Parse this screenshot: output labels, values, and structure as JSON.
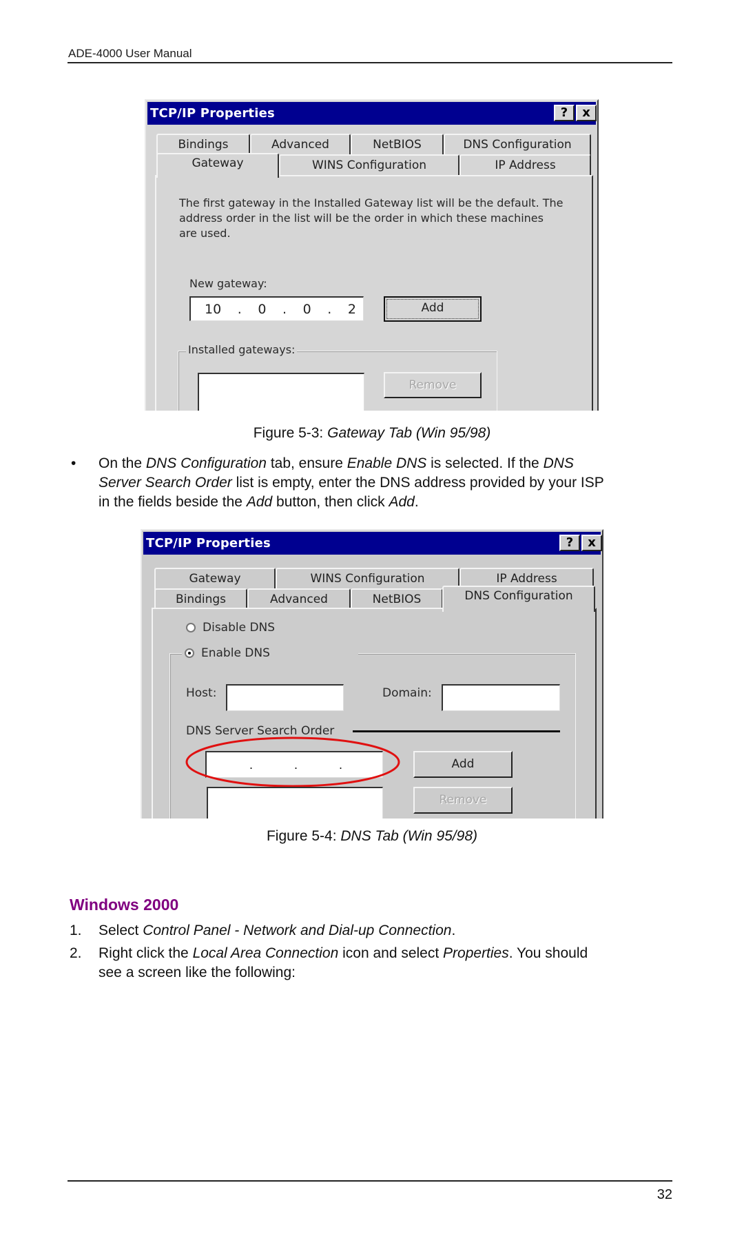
{
  "header": {
    "title": "ADE-4000 User Manual"
  },
  "figure1": {
    "dialog_title": "TCP/IP Properties",
    "help_button": "?",
    "close_button": "x",
    "tabs_row_back": [
      "Bindings",
      "Advanced",
      "NetBIOS",
      "DNS Configuration"
    ],
    "tabs_row_front": [
      "Gateway",
      "WINS Configuration",
      "IP Address"
    ],
    "active_tab": "Gateway",
    "description": [
      "The first gateway in the Installed Gateway list will be the default. The",
      "address order in the list will be the order in which these machines",
      "are used."
    ],
    "new_gateway_label": "New gateway:",
    "new_gateway_value": [
      "10",
      "0",
      "0",
      "2"
    ],
    "add_button": "Add",
    "installed_label": "Installed gateways:",
    "remove_button": "Remove",
    "caption_prefix": "Figure 5-3: ",
    "caption_italic": "Gateway Tab (Win 95/98)"
  },
  "bullet": {
    "symbol": "•",
    "segments": [
      {
        "t": "On the ",
        "i": false
      },
      {
        "t": "DNS Configuration",
        "i": true
      },
      {
        "t": " tab, ensure ",
        "i": false
      },
      {
        "t": "Enable DNS",
        "i": true
      },
      {
        "t": " is selected. If the ",
        "i": false
      },
      {
        "t": "DNS Server Search Order",
        "i": true
      },
      {
        "t": " list is empty, enter the DNS address provided by your ISP in the fields beside the ",
        "i": false
      },
      {
        "t": "Add",
        "i": true
      },
      {
        "t": " button, then click ",
        "i": false
      },
      {
        "t": "Add",
        "i": true
      },
      {
        "t": ".",
        "i": false
      }
    ],
    "lines": [
      [
        {
          "t": "On the ",
          "i": false
        },
        {
          "t": "DNS Configuration",
          "i": true
        },
        {
          "t": " tab, ensure ",
          "i": false
        },
        {
          "t": "Enable DNS",
          "i": true
        },
        {
          "t": " is selected. If the ",
          "i": false
        },
        {
          "t": "DNS",
          "i": true
        }
      ],
      [
        {
          "t": "Server Search Order",
          "i": true
        },
        {
          "t": " list is empty, enter the DNS address provided by your ISP",
          "i": false
        }
      ],
      [
        {
          "t": "in the fields beside the ",
          "i": false
        },
        {
          "t": "Add",
          "i": true
        },
        {
          "t": " button, then click ",
          "i": false
        },
        {
          "t": "Add",
          "i": true
        },
        {
          "t": ".",
          "i": false
        }
      ]
    ]
  },
  "figure2": {
    "dialog_title": "TCP/IP Properties",
    "help_button": "?",
    "close_button": "x",
    "tabs_row_back": [
      "Gateway",
      "WINS Configuration",
      "IP Address"
    ],
    "tabs_row_front": [
      "Bindings",
      "Advanced",
      "NetBIOS",
      "DNS Configuration"
    ],
    "active_tab": "DNS Configuration",
    "disable_dns_label": "Disable DNS",
    "enable_dns_label": "Enable DNS",
    "dns_enabled": true,
    "host_label": "Host:",
    "host_value": "",
    "domain_label": "Domain:",
    "domain_value": "",
    "search_order_label": "DNS Server Search Order",
    "dns_ip_value": [
      "",
      "",
      "",
      ""
    ],
    "add_button": "Add",
    "remove_button": "Remove",
    "highlight_color": "#e01010",
    "caption_prefix": "Figure 5-4: ",
    "caption_italic": "DNS Tab (Win 95/98)"
  },
  "section": {
    "heading": "Windows 2000",
    "heading_color": "#800080",
    "steps": [
      {
        "num": "1.",
        "lines": [
          [
            {
              "t": "Select ",
              "i": false
            },
            {
              "t": "Control Panel - Network and Dial-up Connection",
              "i": true
            },
            {
              "t": ".",
              "i": false
            }
          ]
        ]
      },
      {
        "num": "2.",
        "lines": [
          [
            {
              "t": "Right click the ",
              "i": false
            },
            {
              "t": "Local Area Connection",
              "i": true
            },
            {
              "t": " icon and select ",
              "i": false
            },
            {
              "t": "Properties",
              "i": true
            },
            {
              "t": ". You should",
              "i": false
            }
          ],
          [
            {
              "t": "see a screen like the following:",
              "i": false
            }
          ]
        ]
      }
    ]
  },
  "footer": {
    "page_number": "32"
  }
}
